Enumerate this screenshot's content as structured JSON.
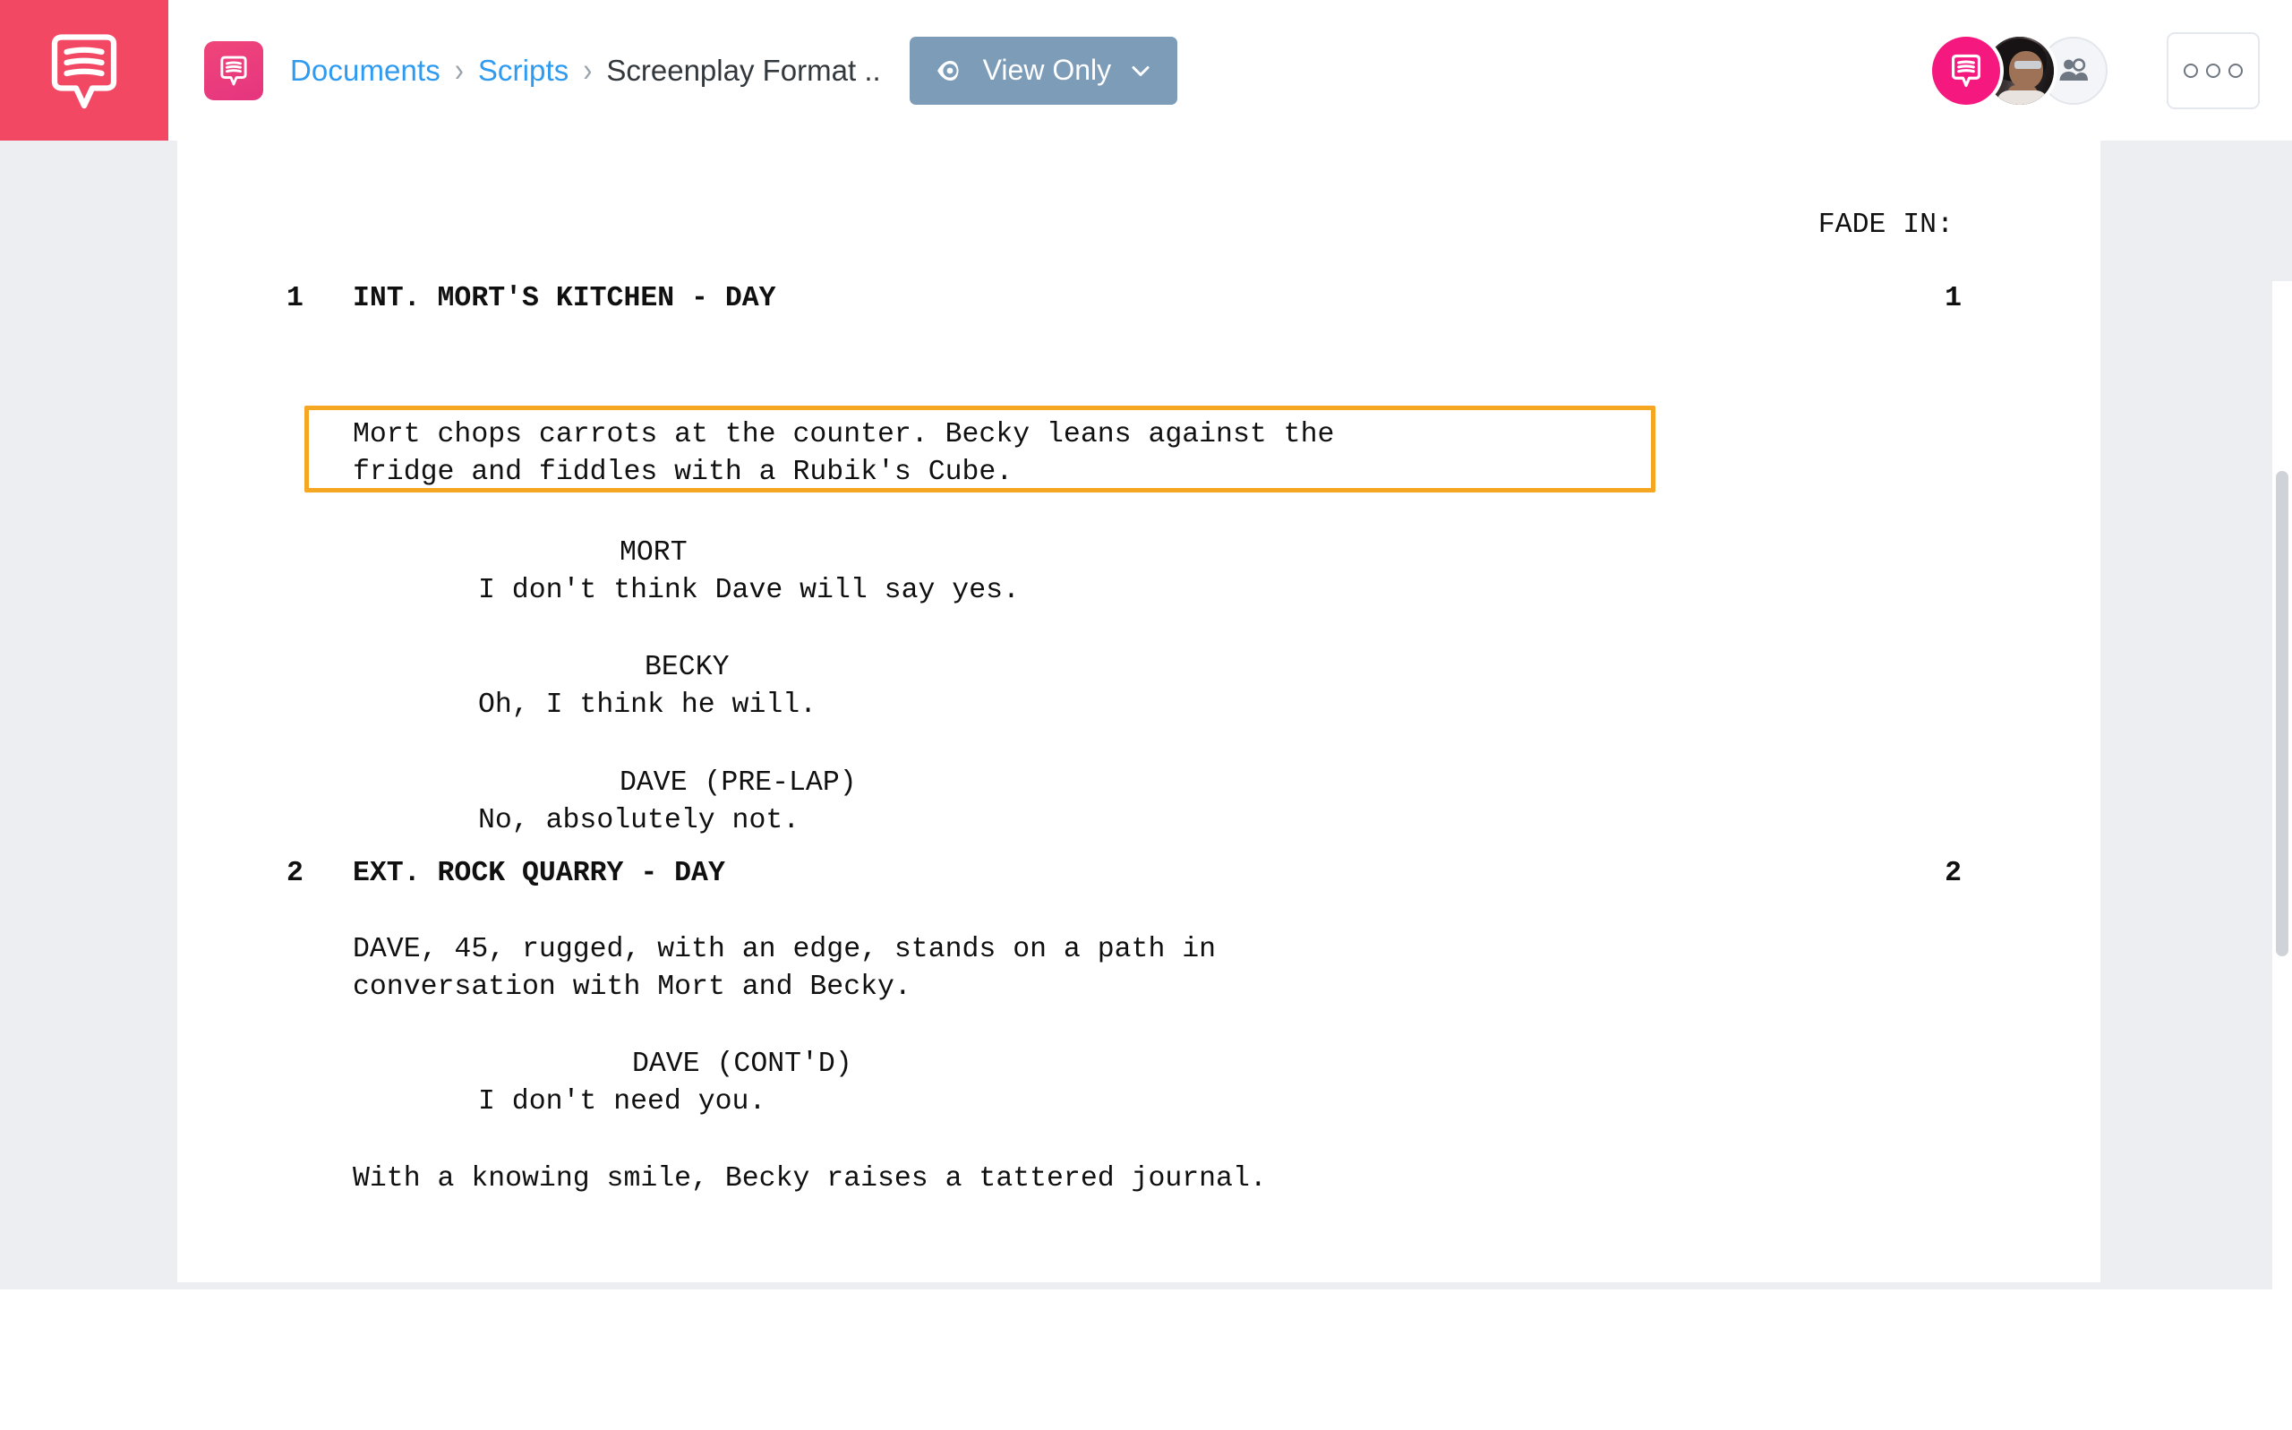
{
  "app": {
    "logo_icon": "speech-bubble-lines-icon",
    "accent_red": "#f24863",
    "accent_pink": "#e5357f",
    "link_blue": "#2e9bf0",
    "view_button_bg": "#7d9cb8",
    "highlight_border": "#f5a623"
  },
  "header": {
    "doc_tile_icon": "speech-bubble-lines-icon",
    "breadcrumb": {
      "items": [
        {
          "label": "Documents",
          "type": "link"
        },
        {
          "label": "Scripts",
          "type": "link"
        },
        {
          "label": "Screenplay Format ..",
          "type": "current"
        }
      ],
      "separator": "›"
    },
    "view_button": {
      "label": "View Only",
      "icon": "eye-icon",
      "chevron": "chevron-down-icon"
    },
    "avatars": [
      {
        "name": "chat-avatar",
        "icon": "speech-bubble-lines-icon"
      },
      {
        "name": "user-avatar-photo",
        "icon": "user-photo"
      },
      {
        "name": "add-collaborator-avatar",
        "icon": "add-people-icon"
      }
    ],
    "more_button": {
      "icon": "three-dots-icon",
      "dots": 3
    }
  },
  "document": {
    "transition": "FADE IN:",
    "scenes": [
      {
        "number": "1",
        "heading": "INT. MORT'S KITCHEN - DAY",
        "highlighted_action": {
          "lines": [
            "Mort chops carrots at the counter. Becky leans against the",
            "fridge and fiddles with a Rubik's Cube."
          ],
          "is_highlighted": true
        },
        "dialogue": [
          {
            "character": "MORT",
            "lines": [
              "I don't think Dave will say yes."
            ]
          },
          {
            "character": "BECKY",
            "lines": [
              "Oh, I think he will."
            ]
          },
          {
            "character": "DAVE (PRE-LAP)",
            "lines": [
              "No, absolutely not."
            ]
          }
        ]
      },
      {
        "number": "2",
        "heading": "EXT. ROCK QUARRY - DAY",
        "action": {
          "lines": [
            "DAVE, 45, rugged, with an edge, stands on a path in",
            "conversation with Mort and Becky."
          ]
        },
        "dialogue": [
          {
            "character": "DAVE (CONT'D)",
            "lines": [
              "I don't need you."
            ]
          }
        ],
        "closing_action": {
          "lines": [
            "With a knowing smile, Becky raises a tattered journal."
          ]
        }
      }
    ]
  },
  "scrollbar": {
    "name": "vertical-scrollbar"
  }
}
